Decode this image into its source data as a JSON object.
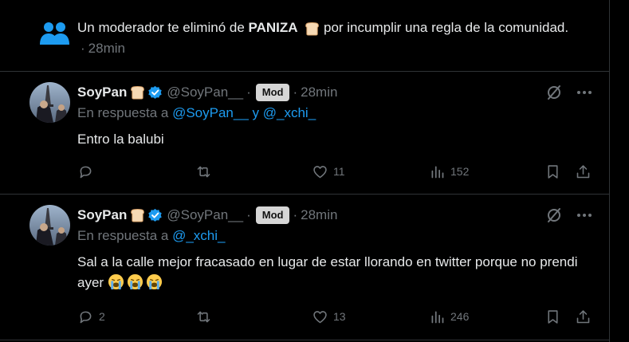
{
  "notice": {
    "prefix": "Un moderador te eliminó de ",
    "community": "PANIZA",
    "suffix": " por incumplir una regla de la comunidad.",
    "time": "28min",
    "icon": "community-icon",
    "icon_color": "#1d9bf0"
  },
  "tweets": [
    {
      "name": "SoyPan",
      "handle": "@SoyPan__",
      "badge": "Mod",
      "time": "28min",
      "reply_prefix": "En respuesta a ",
      "reply_to_1": "@SoyPan__",
      "reply_and": " y ",
      "reply_to_2": "@_xchi_",
      "text": "Entro la balubi",
      "replies": "",
      "retweets": "",
      "likes": "11",
      "views": "152"
    },
    {
      "name": "SoyPan",
      "handle": "@SoyPan__",
      "badge": "Mod",
      "time": "28min",
      "reply_prefix": "En respuesta a ",
      "reply_to_1": "@_xchi_",
      "text": "Sal a la calle mejor fracasado en lugar de estar llorando en twitter porque no prendi ayer",
      "replies": "2",
      "retweets": "",
      "likes": "13",
      "views": "246"
    }
  ],
  "colors": {
    "accent": "#1d9bf0",
    "muted": "#71767b",
    "text": "#e7e9ea",
    "border": "#2f3336",
    "badge_bg": "#d6d6d6"
  }
}
